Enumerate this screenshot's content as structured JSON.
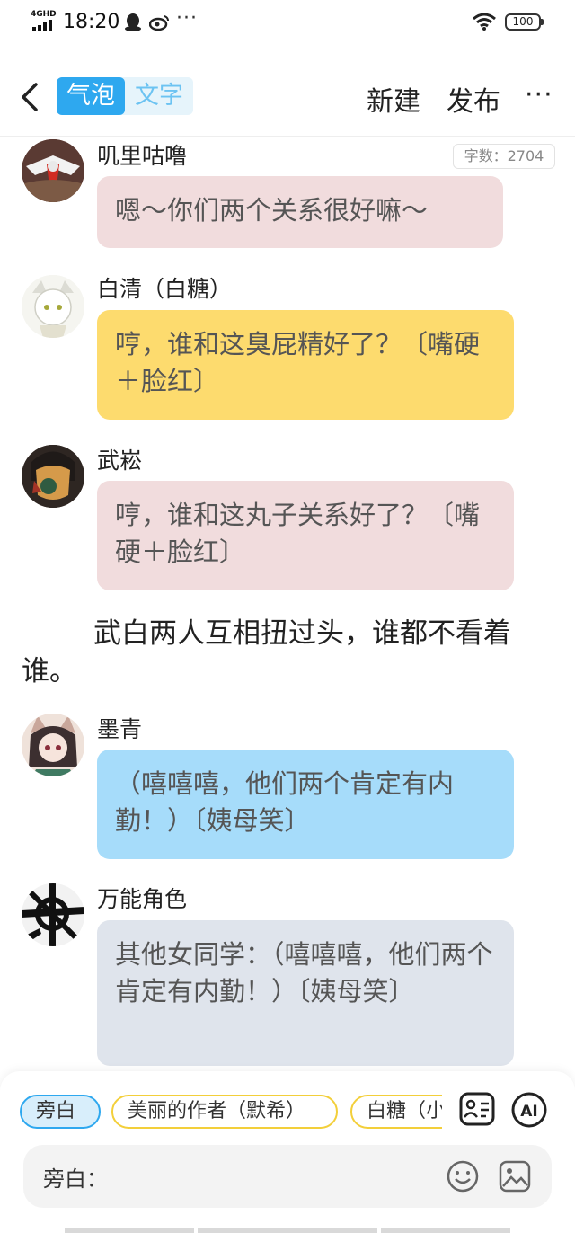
{
  "status_bar": {
    "network": "4GHD",
    "time": "18:20",
    "more": "···",
    "battery": "100"
  },
  "header": {
    "tabs": [
      "气泡",
      "文字"
    ],
    "new_label": "新建",
    "publish_label": "发布",
    "more_label": "···"
  },
  "word_count": "字数：2704",
  "messages": [
    {
      "name": "叽里咕噜",
      "text": "嗯～你们两个关系很好嘛～",
      "bubble_color": "#f1dcdd"
    },
    {
      "name": "白清（白糖）",
      "text": "哼，谁和这臭屁精好了？〔嘴硬＋脸红〕",
      "bubble_color": "#fddb6e"
    },
    {
      "name": "武崧",
      "text": "哼，谁和这丸子关系好了？〔嘴硬＋脸红〕",
      "bubble_color": "#f1dcdd"
    },
    {
      "name": "墨青",
      "text": "（嘻嘻嘻，他们两个肯定有内勤！）〔姨母笑〕",
      "bubble_color": "#a6dcfa"
    },
    {
      "name": "万能角色",
      "text": "其他女同学：（嘻嘻嘻，他们两个肯定有内勤！）〔姨母笑〕",
      "bubble_color": "#dfe4ec"
    }
  ],
  "narration": "武白两人互相扭过头，谁都不看着谁。",
  "bottom_panel": {
    "chips": [
      "旁白",
      "美丽的作者（默希）",
      "白糖（小"
    ],
    "input_label": "旁白：",
    "input_value": ""
  }
}
